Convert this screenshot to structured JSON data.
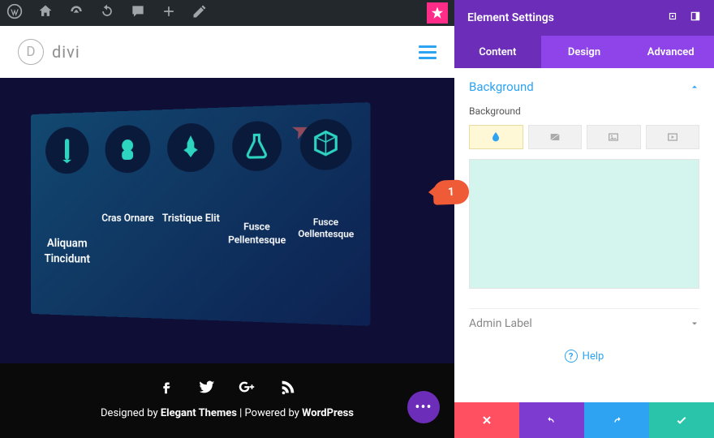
{
  "adminbar": {
    "icons": [
      "wordpress-icon",
      "home-icon",
      "gauge-icon",
      "refresh-icon",
      "comment-icon",
      "plus-icon",
      "pencil-icon"
    ]
  },
  "logo": {
    "mark": "D",
    "text": "divi"
  },
  "hero": {
    "items": [
      {
        "title": "Aliquam Tincidunt"
      },
      {
        "title": "Cras Ornare"
      },
      {
        "title": "Tristique Elit"
      },
      {
        "title": "Fusce Pellentesque"
      },
      {
        "title": "Fusce Oellentesque"
      }
    ]
  },
  "footer": {
    "designed_by": "Designed by ",
    "theme": "Elegant Themes",
    "sep": " | Powered by ",
    "platform": "WordPress"
  },
  "panel": {
    "title": "Element Settings",
    "tabs": [
      "Content",
      "Design",
      "Advanced"
    ],
    "active_tab": 0,
    "section_bg": "Background",
    "sublabel": "Background",
    "section_admin": "Admin Label",
    "help": "Help",
    "swatch_color": "#d4f5ee"
  },
  "pointer": "1"
}
